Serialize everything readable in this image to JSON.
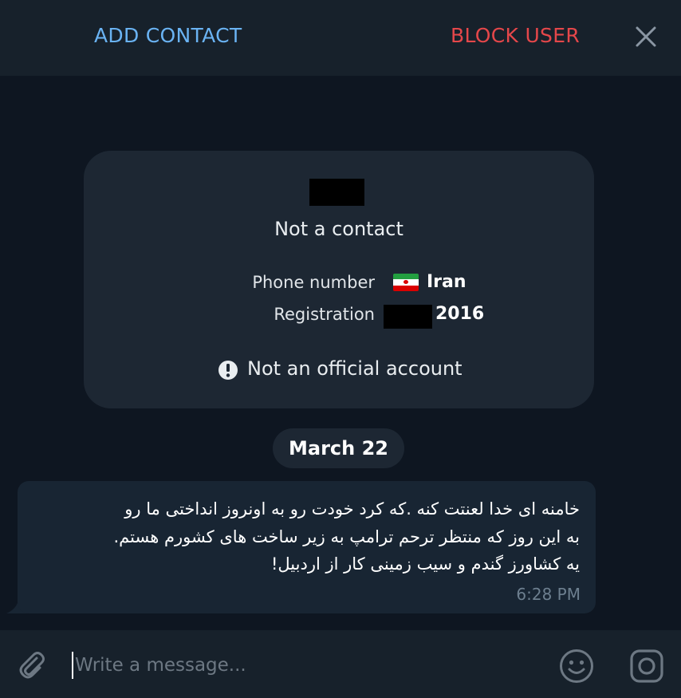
{
  "header": {
    "add_contact_label": "ADD CONTACT",
    "block_user_label": "BLOCK USER",
    "close_icon": "close-icon"
  },
  "info_card": {
    "status": "Not a contact",
    "phone_label": "Phone number",
    "phone_value": "Iran",
    "phone_flag": "iran-flag-icon",
    "registration_label": "Registration",
    "registration_value": "2016",
    "official_note": "Not an official account",
    "official_icon": "exclamation-circle-icon"
  },
  "date_separator": "March 22",
  "message": {
    "lines": [
      "خامنه ای خدا لعنتت کنه .که کرد خودت رو به اونروز انداختی ما رو",
      "به این روز که منتظر ترحم ترامپ به زیر ساخت های کشورم هستم.",
      "یه کشاورز گندم و سیب زمینی کار از اردبیل!"
    ],
    "time": "6:28 PM"
  },
  "composer": {
    "placeholder": "Write a message...",
    "value": "",
    "attach_icon": "paperclip-icon",
    "emoji_icon": "smiley-icon",
    "camera_icon": "instagram-camera-icon"
  },
  "colors": {
    "background": "#0e1621",
    "panel": "#17212b",
    "card": "#1d2733",
    "bubble": "#182533",
    "accent_blue": "#6ab3f3",
    "danger_red": "#e5474a",
    "muted": "#6d7f8f"
  }
}
